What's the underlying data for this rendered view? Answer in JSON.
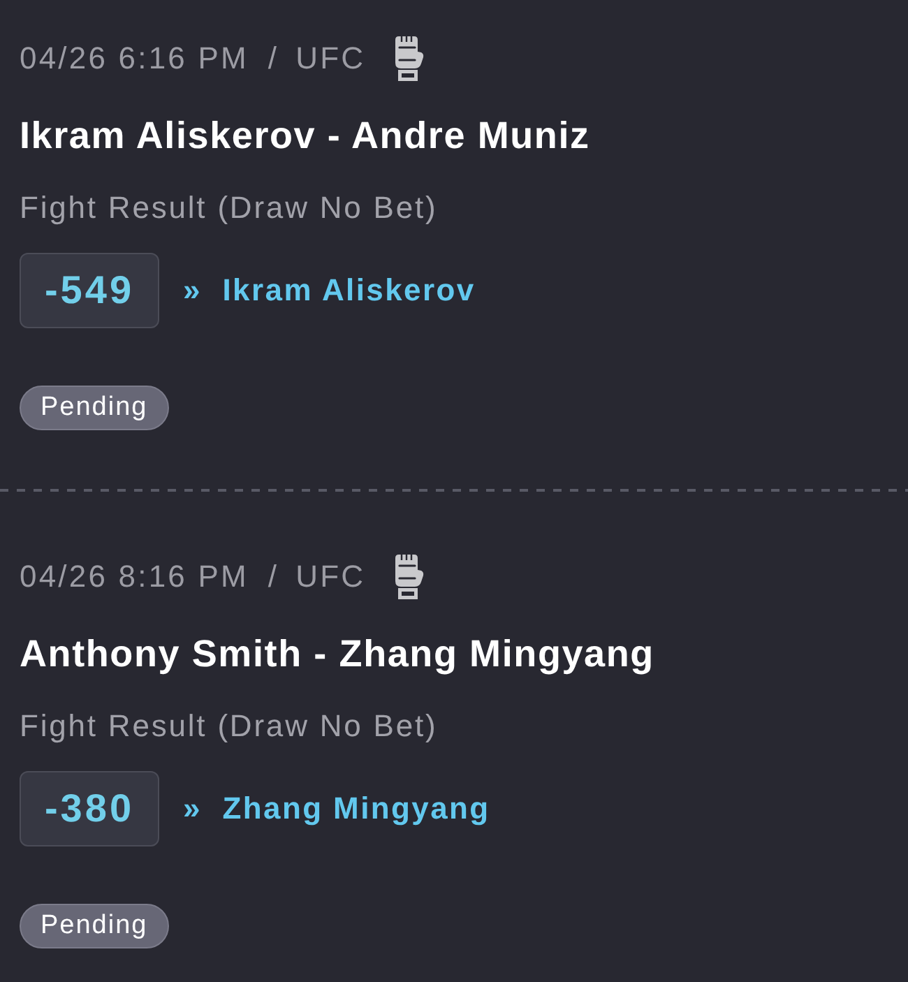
{
  "bets": [
    {
      "date": "04/26 6:16 PM",
      "separator": "/",
      "league": "UFC",
      "event": "Ikram Aliskerov - Andre Muniz",
      "market": "Fight Result (Draw No Bet)",
      "odds": "-549",
      "marker": "»",
      "selection": "Ikram Aliskerov",
      "status": "Pending"
    },
    {
      "date": "04/26 8:16 PM",
      "separator": "/",
      "league": "UFC",
      "event": "Anthony Smith - Zhang Mingyang",
      "market": "Fight Result (Draw No Bet)",
      "odds": "-380",
      "marker": "»",
      "selection": "Zhang Mingyang",
      "status": "Pending"
    }
  ]
}
